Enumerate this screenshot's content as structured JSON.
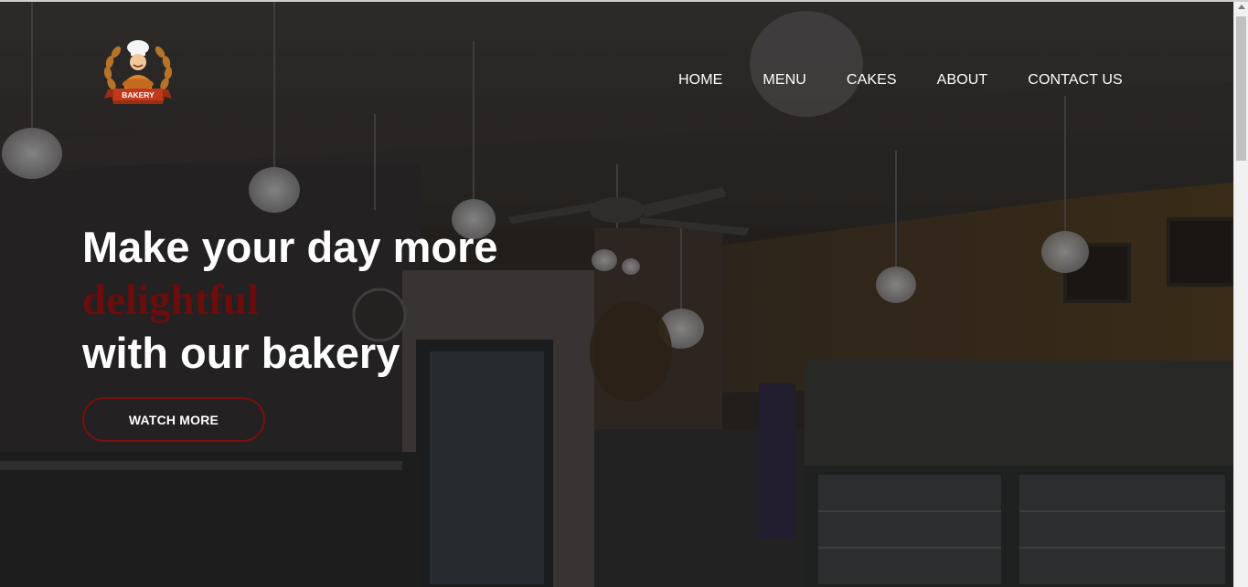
{
  "logo": {
    "banner_text": "BAKERY"
  },
  "nav": {
    "items": [
      {
        "label": "HOME"
      },
      {
        "label": "MENU"
      },
      {
        "label": "CAKES"
      },
      {
        "label": "ABOUT"
      },
      {
        "label": "CONTACT US"
      }
    ]
  },
  "hero": {
    "line1": "Make your day more",
    "accent": "delightful",
    "line3": "with our bakery",
    "cta_label": "WATCH MORE"
  },
  "colors": {
    "accent_dark_red": "#6b0d0d",
    "button_border": "#7a1010",
    "text": "#ffffff",
    "overlay": "#1e1c1a"
  }
}
